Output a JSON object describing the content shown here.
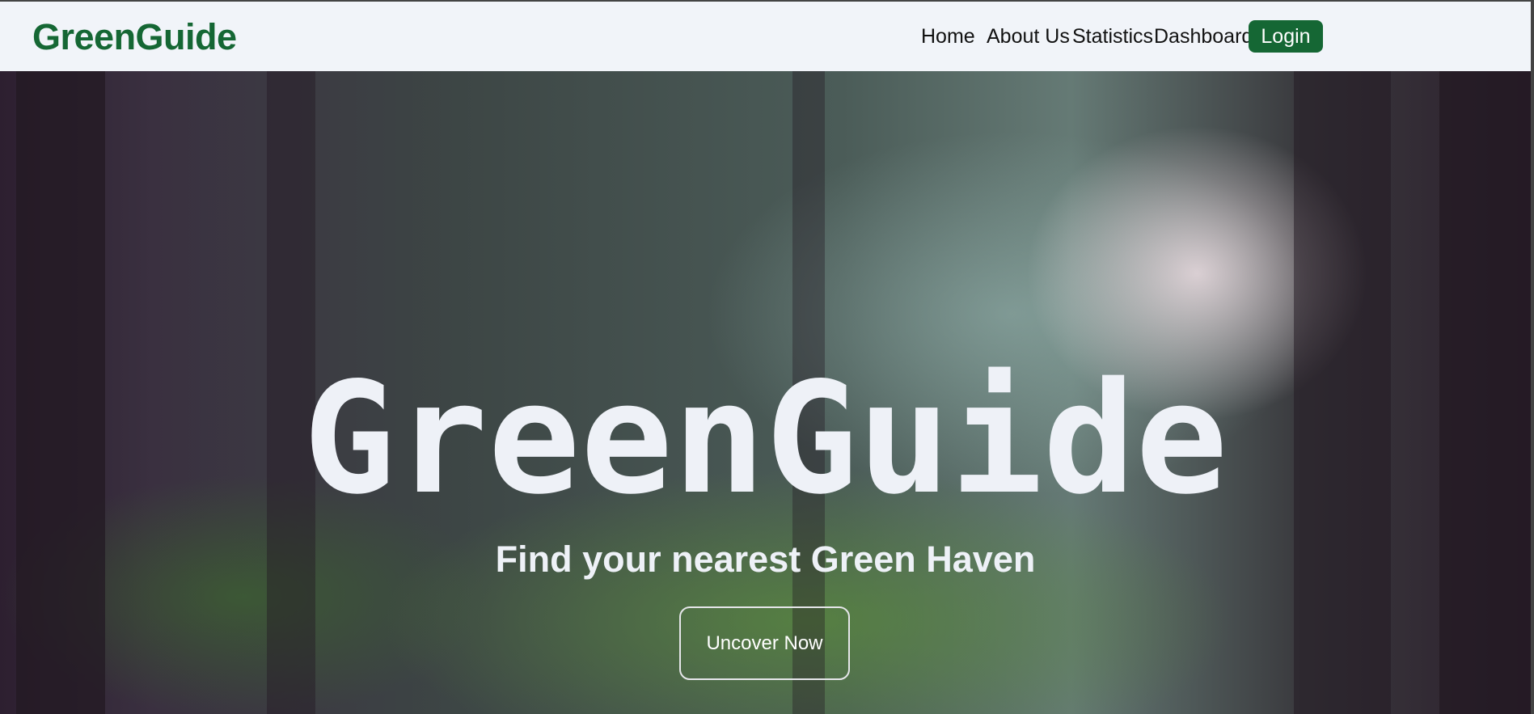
{
  "nav": {
    "logo": "GreenGuide",
    "links": [
      "Home",
      "About Us",
      "Statistics",
      "Dashboard"
    ],
    "login_label": "Login"
  },
  "hero": {
    "title": "GreenGuide",
    "subtitle": "Find your nearest Green Haven",
    "cta_label": "Uncover Now"
  },
  "colors": {
    "brand": "#156734",
    "nav_bg": "#f1f4f9",
    "hero_text": "#eef1f7"
  }
}
